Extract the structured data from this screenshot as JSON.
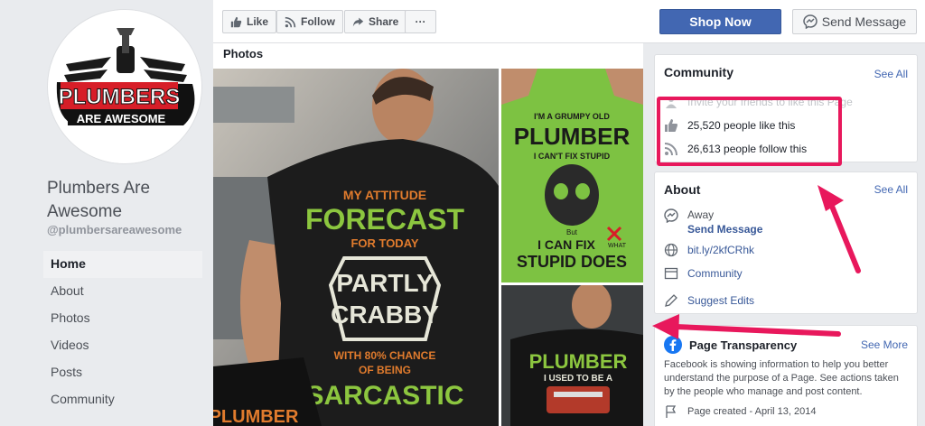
{
  "page": {
    "name": "Plumbers Are Awesome",
    "handle": "@plumbersareawesome",
    "logo_text_1": "PLUMBERS",
    "logo_text_2": "ARE AWESOME"
  },
  "nav": {
    "items": [
      {
        "label": "Home"
      },
      {
        "label": "About"
      },
      {
        "label": "Photos"
      },
      {
        "label": "Videos"
      },
      {
        "label": "Posts"
      },
      {
        "label": "Community"
      }
    ]
  },
  "actions": {
    "like": "Like",
    "follow": "Follow",
    "share": "Share",
    "more": "···",
    "shop_now": "Shop Now",
    "send_message": "Send Message"
  },
  "photos": {
    "title": "Photos",
    "main_shirt": [
      "MY ATTITUDE",
      "FORECAST",
      "FOR TODAY",
      "PARTLY",
      "CRABBY",
      "WITH 80% CHANCE",
      "OF BEING",
      "SARCASTIC"
    ],
    "top_right_shirt": [
      "I'M A GRUMPY OLD",
      "PLUMBER",
      "I CAN'T FIX STUPID",
      "But",
      "I CAN FIX",
      "WHAT",
      "STUPID DOES"
    ],
    "bottom_right_shirt": [
      "PLUMBER",
      "I USED TO BE A"
    ],
    "bottom_left_shirt": "PLUMBER"
  },
  "community": {
    "title": "Community",
    "see_all": "See All",
    "invite": "Invite your friends to like this Page",
    "likes": "25,520 people like this",
    "follows": "26,613 people follow this"
  },
  "about": {
    "title": "About",
    "see_all": "See All",
    "status": "Away",
    "send_message": "Send Message",
    "link": "bit.ly/2kfCRhk",
    "category": "Community",
    "suggest": "Suggest Edits"
  },
  "transparency": {
    "title": "Page Transparency",
    "see_more": "See More",
    "description": "Facebook is showing information to help you better understand the purpose of a Page. See actions taken by the people who manage and post content.",
    "created": "Page created - April 13, 2014"
  },
  "colors": {
    "accent": "#4267b2",
    "annotation": "#e8185c",
    "shirt_green": "#7dc242"
  }
}
